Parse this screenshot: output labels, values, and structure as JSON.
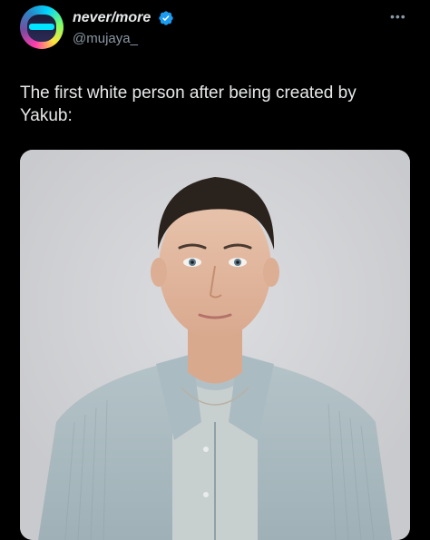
{
  "author": {
    "display_name": "never/more",
    "handle": "@mujaya_",
    "verified": true
  },
  "tweet": {
    "text": "The first white person after being created by Yakub:"
  },
  "icons": {
    "verified": "verified-badge-icon",
    "more": "more-options-icon"
  },
  "colors": {
    "background": "#000000",
    "text": "#e7e9ea",
    "secondary_text": "#8b98a5",
    "verified_blue": "#1d9bf0"
  }
}
